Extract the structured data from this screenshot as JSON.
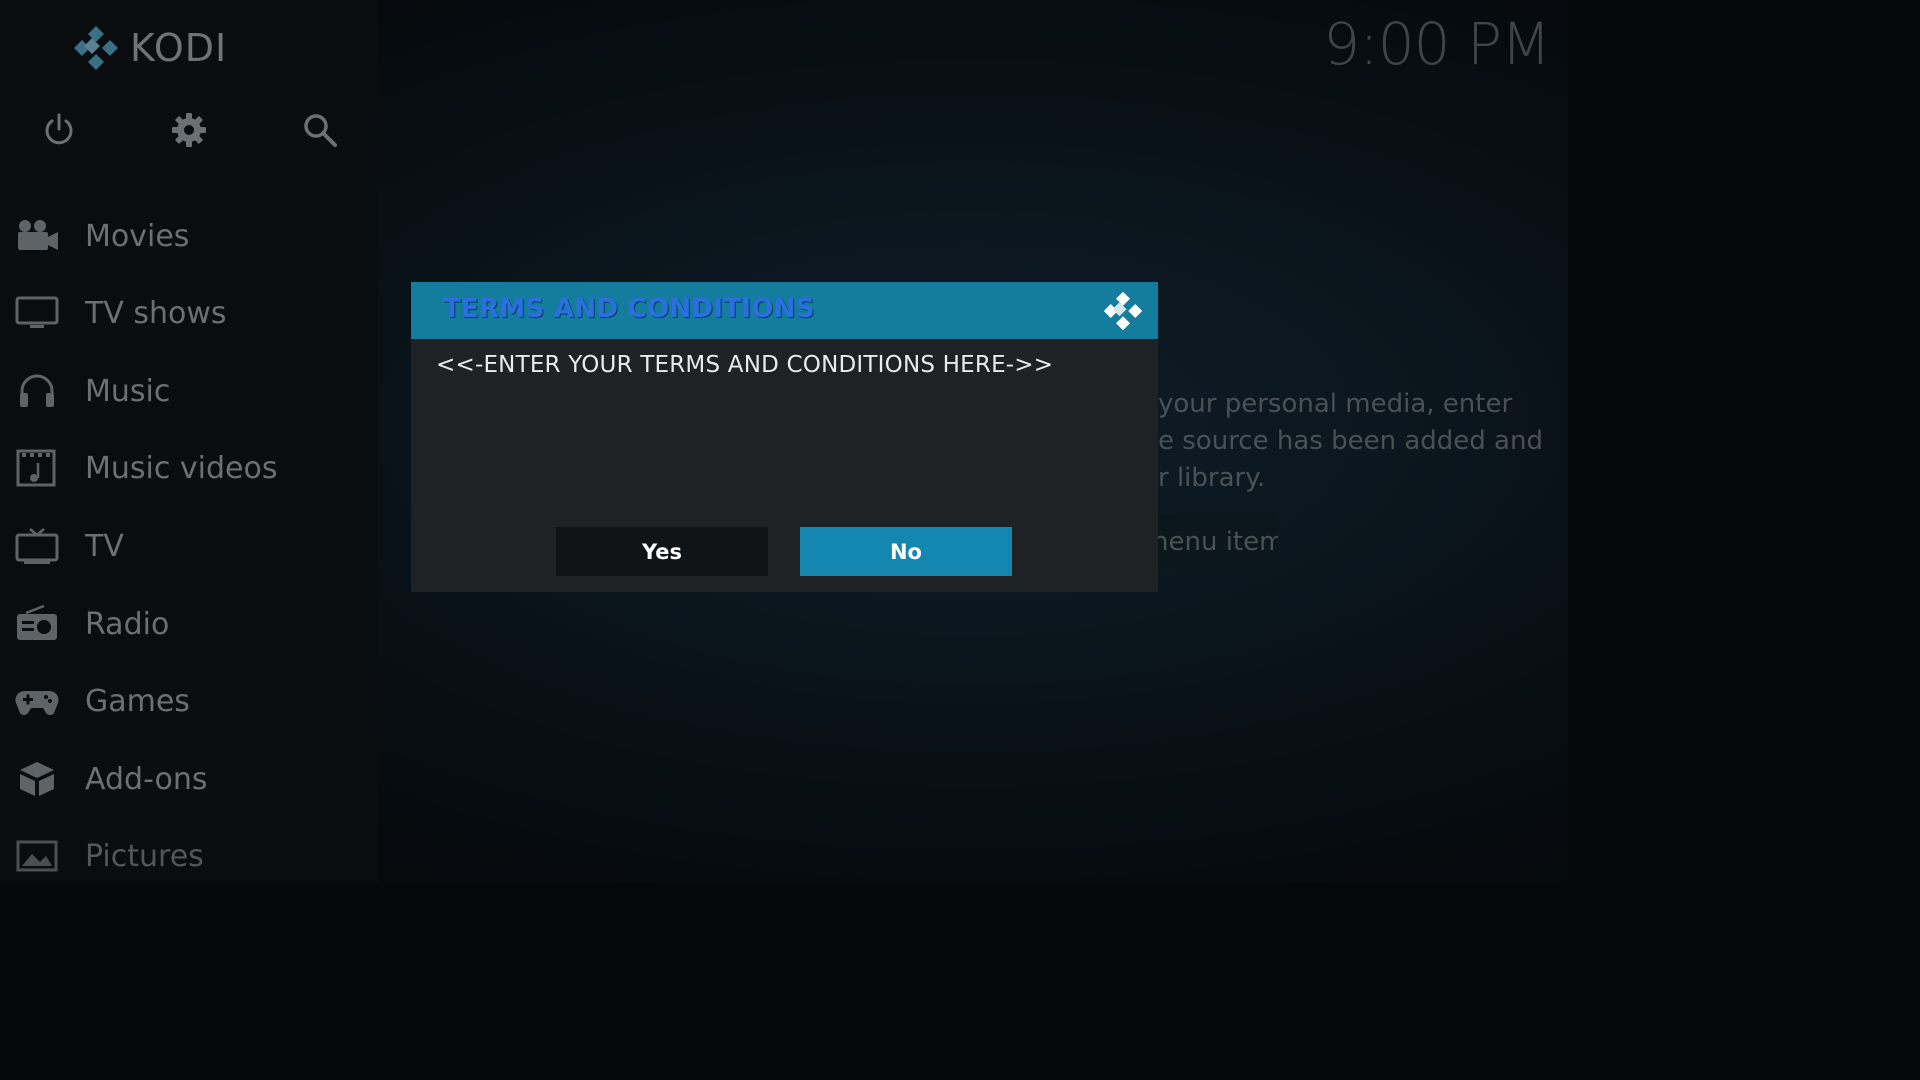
{
  "app": {
    "logo_text": "KODI"
  },
  "clock": "9:00 PM",
  "top_icons": [
    "power-icon",
    "gear-icon",
    "search-icon"
  ],
  "sidebar": {
    "items": [
      {
        "label": "Movies",
        "icon": "movie-camera-icon"
      },
      {
        "label": "TV shows",
        "icon": "monitor-icon"
      },
      {
        "label": "Music",
        "icon": "headphones-icon"
      },
      {
        "label": "Music videos",
        "icon": "music-video-icon"
      },
      {
        "label": "TV",
        "icon": "tv-icon"
      },
      {
        "label": "Radio",
        "icon": "radio-icon"
      },
      {
        "label": "Games",
        "icon": "gamepad-icon"
      },
      {
        "label": "Add-ons",
        "icon": "addons-box-icon"
      },
      {
        "label": "Pictures",
        "icon": "picture-icon"
      }
    ]
  },
  "background_info": {
    "lines": [
      "your personal media, enter",
      "e source has been added and",
      "r library."
    ],
    "button_label": "nenu item"
  },
  "dialog": {
    "title": "TERMS AND CONDITIONS",
    "body": "<<-ENTER YOUR TERMS AND CONDITIONS HERE->>",
    "yes_label": "Yes",
    "no_label": "No"
  },
  "colors": {
    "accent": "#1487b0",
    "header": "#147c9c",
    "title_text": "#2a6fe0",
    "dialog_bg": "#1e2225"
  }
}
